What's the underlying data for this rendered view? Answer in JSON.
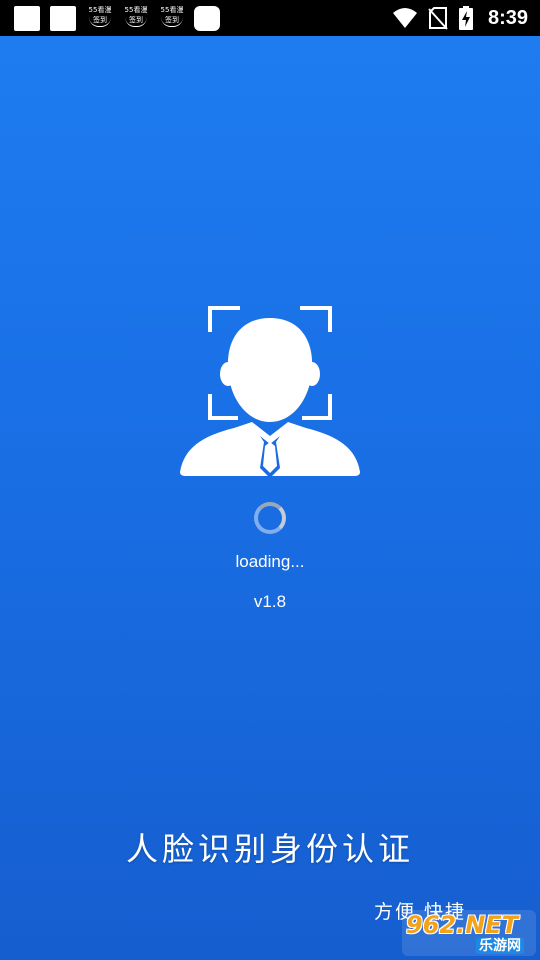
{
  "status_bar": {
    "time": "8:39",
    "notifications": [
      {
        "top": "55看漫",
        "bottom": "签到"
      },
      {
        "top": "55看漫",
        "bottom": "签到"
      },
      {
        "top": "55看漫",
        "bottom": "签到"
      }
    ],
    "icons": [
      "wifi-icon",
      "no-sim-icon",
      "battery-charging-icon"
    ]
  },
  "splash": {
    "loading_text": "loading...",
    "version": "v1.8",
    "slogan": "人脸识别身份认证",
    "tagline": "方便  快捷"
  },
  "watermark": {
    "main": "962.NET",
    "sub": "乐游网"
  },
  "colors": {
    "background_top": "#1e7cf0",
    "background_bottom": "#155ed0",
    "status_bar": "#000000",
    "text": "#ffffff"
  }
}
